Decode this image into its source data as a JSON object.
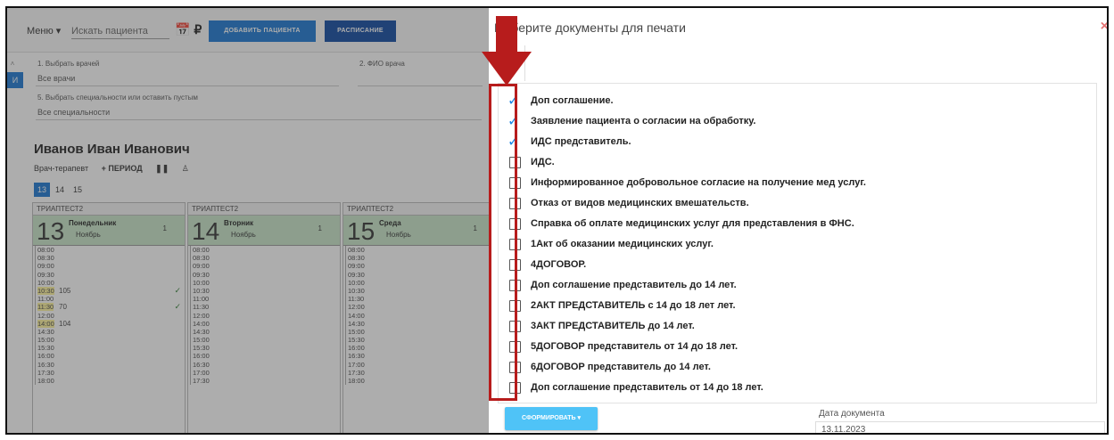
{
  "app": {
    "menu_label": "Меню ▾",
    "search_placeholder": "Искать пациента",
    "add_patient_label": "ДОБАВИТЬ ПАЦИЕНТА",
    "schedule_label": "РАСПИСАНИЕ",
    "side_tab": "И",
    "filters": {
      "choose_doctor_label": "1. Выбрать врачей",
      "choose_doctor_value": "Все врачи",
      "doctor_name_label": "2. ФИО врача",
      "specialty_label": "5. Выбрать специальности или оставить пустым",
      "specialty_value": "Все специальности"
    },
    "doctor": {
      "name": "Иванов Иван Иванович",
      "role": "Врач-терапевт",
      "period_button": "+ ПЕРИОД"
    },
    "days": [
      "13",
      "14",
      "15"
    ],
    "columns": [
      {
        "header": "ТРИАПТЕСТ2",
        "day": "13",
        "weekday": "Понедельник",
        "month": "Ноябрь",
        "count": "1",
        "slots": [
          {
            "t": "08:00"
          },
          {
            "t": "08:30"
          },
          {
            "t": "09:00"
          },
          {
            "t": "09:30"
          },
          {
            "t": "10:00"
          },
          {
            "t": "10:30",
            "p": "105",
            "c": true
          },
          {
            "t": "11:00"
          },
          {
            "t": "11:30",
            "p": "70",
            "c": true
          },
          {
            "t": "12:00"
          },
          {
            "t": "14:00",
            "p": "104"
          },
          {
            "t": "14:30"
          },
          {
            "t": "15:00"
          },
          {
            "t": "15:30"
          },
          {
            "t": "16:00"
          },
          {
            "t": "16:30"
          },
          {
            "t": "17:30"
          },
          {
            "t": "18:00"
          }
        ]
      },
      {
        "header": "ТРИАПТЕСТ2",
        "day": "14",
        "weekday": "Вторник",
        "month": "Ноябрь",
        "count": "1",
        "slots": [
          {
            "t": "08:00"
          },
          {
            "t": "08:30"
          },
          {
            "t": "09:00"
          },
          {
            "t": "09:30"
          },
          {
            "t": "10:00"
          },
          {
            "t": "10:30"
          },
          {
            "t": "11:00"
          },
          {
            "t": "11:30"
          },
          {
            "t": "12:00"
          },
          {
            "t": "14:00"
          },
          {
            "t": "14:30"
          },
          {
            "t": "15:00"
          },
          {
            "t": "15:30"
          },
          {
            "t": "16:00"
          },
          {
            "t": "16:30"
          },
          {
            "t": "17:00"
          },
          {
            "t": "17:30"
          }
        ]
      },
      {
        "header": "ТРИАПТЕСТ2",
        "day": "15",
        "weekday": "Среда",
        "month": "Ноябрь",
        "count": "1",
        "slots": [
          {
            "t": "08:00"
          },
          {
            "t": "08:30"
          },
          {
            "t": "09:00"
          },
          {
            "t": "09:30"
          },
          {
            "t": "10:00"
          },
          {
            "t": "10:30"
          },
          {
            "t": "11:30"
          },
          {
            "t": "12:00"
          },
          {
            "t": "14:00"
          },
          {
            "t": "14:30"
          },
          {
            "t": "15:00"
          },
          {
            "t": "15:30"
          },
          {
            "t": "16:00"
          },
          {
            "t": "16:30"
          },
          {
            "t": "17:00"
          },
          {
            "t": "17:30"
          },
          {
            "t": "18:00"
          }
        ]
      }
    ]
  },
  "dialog": {
    "title": "Выберите документы для печати",
    "close_symbol": "×",
    "documents": [
      {
        "label": "Доп соглашение.",
        "checked": true
      },
      {
        "label": "Заявление пациента о согласии на обработку.",
        "checked": true
      },
      {
        "label": "ИДС представитель.",
        "checked": true
      },
      {
        "label": "ИДС.",
        "checked": false
      },
      {
        "label": "Информированное добровольное согласие на получение мед услуг.",
        "checked": false
      },
      {
        "label": "Отказ от видов медицинских вмешательств.",
        "checked": false
      },
      {
        "label": "Справка об оплате медицинских услуг для представления в ФНС.",
        "checked": false
      },
      {
        "label": "1Акт об оказании медицинских услуг.",
        "checked": false
      },
      {
        "label": "4ДОГОВОР.",
        "checked": false
      },
      {
        "label": "Доп соглашение представитель до 14 лет.",
        "checked": false
      },
      {
        "label": "2АКТ ПРЕДСТАВИТЕЛЬ с 14 до 18 лет лет.",
        "checked": false
      },
      {
        "label": "3АКТ ПРЕДСТАВИТЕЛЬ до 14 лет.",
        "checked": false
      },
      {
        "label": "5ДОГОВОР представитель от 14 до 18 лет.",
        "checked": false
      },
      {
        "label": "6ДОГОВОР представитель до 14 лет.",
        "checked": false
      },
      {
        "label": "Доп соглашение представитель от 14 до 18 лет.",
        "checked": false
      }
    ],
    "generate_button": "СФОРМИРОВАТЬ ▾",
    "date_label": "Дата документа",
    "date_value": "13.11.2023"
  },
  "colors": {
    "accent": "#1976d2",
    "check": "#1e88e5",
    "annotation": "#b71c1c",
    "day_header": "#c8e6c9"
  }
}
